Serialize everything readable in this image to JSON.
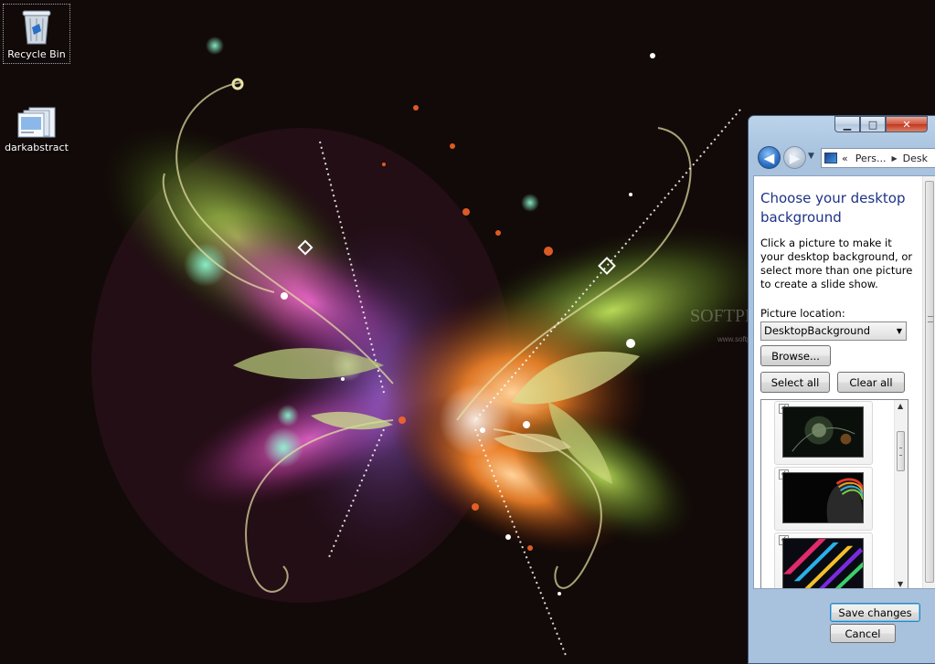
{
  "desktop": {
    "icons": [
      {
        "label": "Recycle Bin"
      },
      {
        "label": "darkabstract"
      }
    ],
    "watermark": "SOFTPEDIA",
    "watermark_url": "www.softpedia.com"
  },
  "window": {
    "caption_buttons": {
      "minimize": "▁",
      "maximize": "□",
      "close": "✕"
    },
    "nav": {
      "back": "◀",
      "forward": "▶",
      "history": "▼",
      "breadcrumb": [
        "«",
        "Pers...",
        "Desk"
      ]
    },
    "content": {
      "heading": "Choose your desktop background",
      "description": "Click a picture to make it your desktop background, or select more than one picture to create a slide show.",
      "location_label": "Picture location:",
      "location_value": "DesktopBackground",
      "browse": "Browse...",
      "select_all": "Select all",
      "clear_all": "Clear all",
      "thumbnails": [
        {
          "checked": true,
          "check": "✓"
        },
        {
          "checked": true,
          "check": "✓"
        },
        {
          "checked": true,
          "check": "✓"
        }
      ]
    },
    "footer": {
      "save": "Save changes",
      "cancel": "Cancel"
    }
  },
  "colors": {
    "heading": "#1e3287",
    "window_frame": "#a9c3df",
    "desktop_bg": "#120a08"
  }
}
